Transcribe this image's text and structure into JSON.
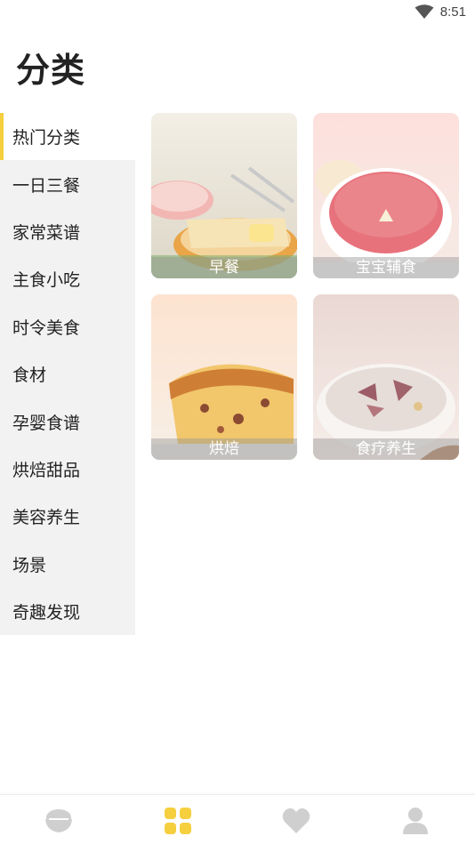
{
  "status": {
    "time": "8:51",
    "wifi_icon": "wifi-icon"
  },
  "page_title": "分类",
  "colors": {
    "accent": "#f6cf3e",
    "sidebar_bg": "#f2f2f2",
    "tab_inactive": "#cfcfcf"
  },
  "sidebar": {
    "items": [
      {
        "label": "热门分类",
        "active": true
      },
      {
        "label": "一日三餐"
      },
      {
        "label": "家常菜谱"
      },
      {
        "label": "主食小吃"
      },
      {
        "label": "时令美食"
      },
      {
        "label": "食材"
      },
      {
        "label": "孕婴食谱"
      },
      {
        "label": "烘焙甜品"
      },
      {
        "label": "美容养生"
      },
      {
        "label": "场景"
      },
      {
        "label": "奇趣发现"
      }
    ]
  },
  "cards": [
    {
      "label": "早餐",
      "image": "toast-breakfast-image"
    },
    {
      "label": "宝宝辅食",
      "image": "baby-puree-image"
    },
    {
      "label": "烘焙",
      "image": "pound-cake-image"
    },
    {
      "label": "食疗养生",
      "image": "soup-bowl-image"
    }
  ],
  "tabbar": {
    "tabs": [
      {
        "icon": "rice-bowl-icon",
        "active": false
      },
      {
        "icon": "category-grid-icon",
        "active": true
      },
      {
        "icon": "heart-icon",
        "active": false
      },
      {
        "icon": "person-icon",
        "active": false
      }
    ]
  }
}
